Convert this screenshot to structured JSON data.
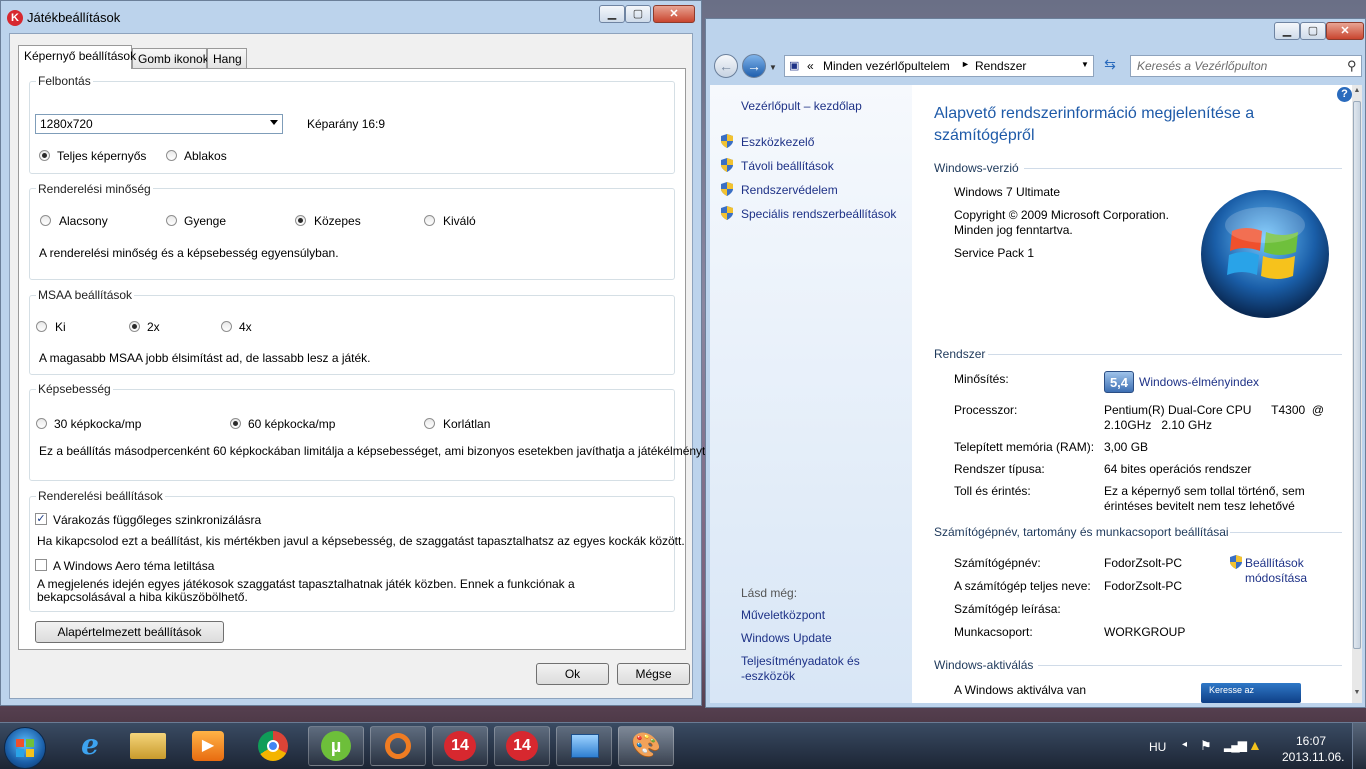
{
  "game_window": {
    "title": "Játékbeállítások",
    "tabs": [
      "Képernyő beállítások",
      "Gomb ikonok",
      "Hang"
    ],
    "resolution": {
      "group": "Felbontás",
      "selected": "1280x720",
      "aspect": "Képarány 16:9",
      "modes": [
        "Teljes képernyős",
        "Ablakos"
      ]
    },
    "render_quality": {
      "group": "Renderelési minőség",
      "options": [
        "Alacsony",
        "Gyenge",
        "Közepes",
        "Kiváló"
      ],
      "note": "A renderelési minőség és a képsebesség egyensúlyban."
    },
    "msaa": {
      "group": "MSAA beállítások",
      "options": [
        "Ki",
        "2x",
        "4x"
      ],
      "note": "A magasabb MSAA jobb élsimítást ad, de lassabb lesz a játék."
    },
    "fps": {
      "group": "Képsebesség",
      "options": [
        "30 képkocka/mp",
        "60 képkocka/mp",
        "Korlátlan"
      ],
      "note": "Ez a beállítás másodpercenként 60 képkockában limitálja a képsebességet, ami bizonyos esetekben javíthatja a játékélményt."
    },
    "render_settings": {
      "group": "Renderelési beállítások",
      "vsync_label": "Várakozás függőleges szinkronizálásra",
      "vsync_note": "Ha kikapcsolod ezt a beállítást, kis mértékben javul a képsebesség, de szaggatást tapasztalhatsz az egyes kockák között.",
      "aero_label": "A Windows Aero téma letiltása",
      "aero_note": "A megjelenés idején egyes játékosok szaggatást tapasztalhatnak játék közben. Ennek a funkciónak a bekapcsolásával a hiba kiküszöbölhető."
    },
    "defaults_button": "Alapértelmezett beállítások",
    "ok_button": "Ok",
    "cancel_button": "Mégse"
  },
  "control_panel": {
    "breadcrumb_root": "Minden vezérlőpultelem",
    "breadcrumb_current": "Rendszer",
    "search_placeholder": "Keresés a Vezérlőpulton",
    "home_link": "Vezérlőpult – kezdőlap",
    "links": [
      "Eszközkezelő",
      "Távoli beállítások",
      "Rendszervédelem",
      "Speciális rendszerbeállítások"
    ],
    "see_also_title": "Lásd még:",
    "see_also": [
      "Műveletközpont",
      "Windows Update",
      "Teljesítményadatok és",
      "-eszközök"
    ],
    "page_title_1": "Alapvető rendszerinformáció megjelenítése a",
    "page_title_2": "számítógépről",
    "win_version_title": "Windows-verzió",
    "edition": "Windows 7 Ultimate",
    "copyright_1": "Copyright © 2009 Microsoft Corporation.",
    "copyright_2": "Minden jog fenntartva.",
    "service_pack": "Service Pack 1",
    "system_title": "Rendszer",
    "rating_label": "Minősítés:",
    "rating_value": "5,4",
    "rating_link": "Windows-élményindex",
    "cpu_label": "Processzor:",
    "cpu_value_1": "Pentium(R) Dual-Core CPU      T4300  @",
    "cpu_value_2": "2.10GHz   2.10 GHz",
    "ram_label": "Telepített memória (RAM):",
    "ram_value": "3,00 GB",
    "type_label": "Rendszer típusa:",
    "type_value": "64 bites operációs rendszer",
    "pen_label": "Toll és érintés:",
    "pen_value_1": "Ez a képernyő sem tollal történő, sem",
    "pen_value_2": "érintéses bevitelt nem tesz lehetővé",
    "computer_title": "Számítógépnév, tartomány és munkacsoport beállításai",
    "name_label": "Számítógépnév:",
    "name_value": "FodorZsolt-PC",
    "fullname_label": "A számítógép teljes neve:",
    "fullname_value": "FodorZsolt-PC",
    "desc_label": "Számítógép leírása:",
    "workgroup_label": "Munkacsoport:",
    "workgroup_value": "WORKGROUP",
    "change_link_1": "Beállítások",
    "change_link_2": "módosítása",
    "activation_title": "Windows-aktiválás",
    "activation_status": "A Windows aktiválva van",
    "genuine_badge": "Keresse az"
  },
  "taskbar": {
    "badge_14": "14",
    "lang": "HU",
    "time": "16:07",
    "date": "2013.11.06."
  },
  "colors": {
    "accent": "#1e3287",
    "title_blue": "#1e5aa8"
  }
}
